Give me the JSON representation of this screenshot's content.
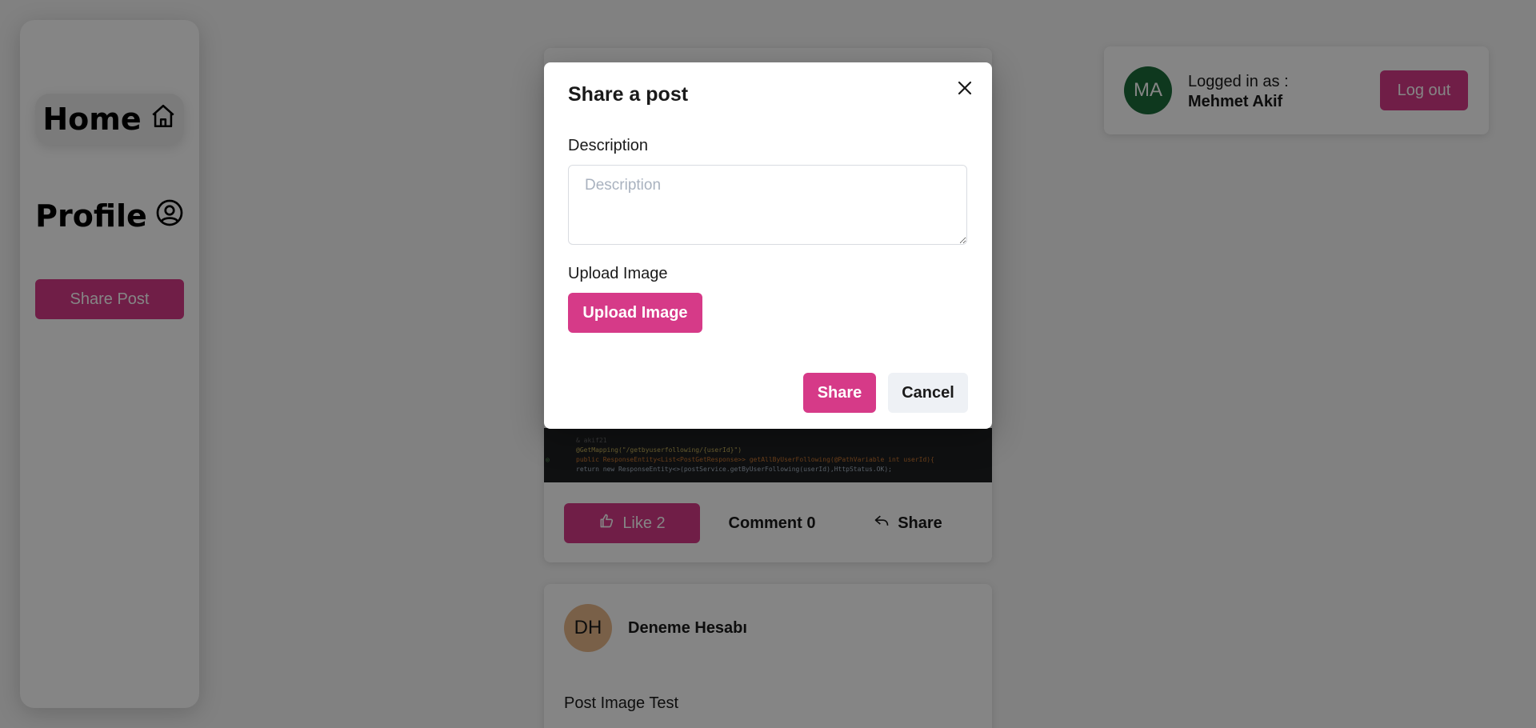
{
  "sidebar": {
    "home_label": "Home",
    "profile_label": "Profile",
    "share_post_label": "Share Post"
  },
  "user_card": {
    "avatar_initials": "MA",
    "logged_in_label": "Logged in as :",
    "username": "Mehmet Akif",
    "logout_label": "Log out"
  },
  "feed": {
    "post1": {
      "code_lines": [
        "& akif21",
        "@GetMapping(\"/getbyuserfollowing/{userId}\")",
        "public ResponseEntity<List<PostGetResponse>> getAllByUserFollowing(@PathVariable int userId){",
        "    return new ResponseEntity<>(postService.getByUserFollowing(userId),HttpStatus.OK);"
      ],
      "like_label": "Like 2",
      "comment_label": "Comment 0",
      "share_label": "Share"
    },
    "post2": {
      "avatar_initials": "DH",
      "author": "Deneme Hesabı",
      "description": "Post Image Test"
    }
  },
  "modal": {
    "title": "Share a post",
    "description_label": "Description",
    "description_placeholder": "Description",
    "description_value": "",
    "upload_label": "Upload Image",
    "upload_button": "Upload Image",
    "share_button": "Share",
    "cancel_button": "Cancel"
  },
  "colors": {
    "accent": "#d63a88",
    "avatar_ma": "#1c6c3a",
    "avatar_dh": "#e9b98a",
    "overlay": "rgba(0,0,0,0.48)"
  }
}
